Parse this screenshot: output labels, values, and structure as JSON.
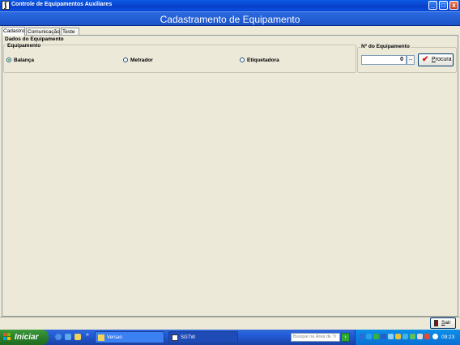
{
  "window": {
    "title": "Controle de Equipamentos Auxiliares",
    "controls": {
      "minimize": "_",
      "maximize": "□",
      "close": "x"
    }
  },
  "banner": {
    "title": "Cadastramento de Equipamento"
  },
  "tabs": [
    {
      "label": "Cadastro",
      "active": true
    },
    {
      "label": "Comunicação",
      "active": false
    },
    {
      "label": "Teste",
      "active": false
    }
  ],
  "equipment_data": {
    "section_label": "Dados do Equipamento",
    "equipment_group": {
      "label": "Equipamento",
      "options": [
        {
          "label": "Balança",
          "selected": true
        },
        {
          "label": "Metrador",
          "selected": false
        },
        {
          "label": "Etiquetadora",
          "selected": false
        }
      ]
    },
    "number_group": {
      "label": "Nº do Equipamento",
      "value": "0",
      "ellipsis": "...",
      "search_label": "Procura",
      "search_icon": "checkmark-icon"
    }
  },
  "footer": {
    "exit_label": "Sair",
    "exit_icon": "door-exit-icon"
  },
  "taskbar": {
    "start_label": "Iniciar",
    "chevron": "»",
    "tasks": [
      {
        "label": "Versao",
        "icon": "folder-icon",
        "active": false
      },
      {
        "label": "SGTW",
        "icon": "app-icon",
        "active": true
      }
    ],
    "search_placeholder": "Busque na Área de Tr",
    "search_go": "›",
    "clock": "09:23"
  },
  "colors": {
    "title_bar": "#0a4ee0",
    "banner": "#2360d6",
    "window_bg": "#ece9d8",
    "start_button": "#2b7f2b",
    "taskbar": "#245edb",
    "search_check": "#dd1111"
  }
}
